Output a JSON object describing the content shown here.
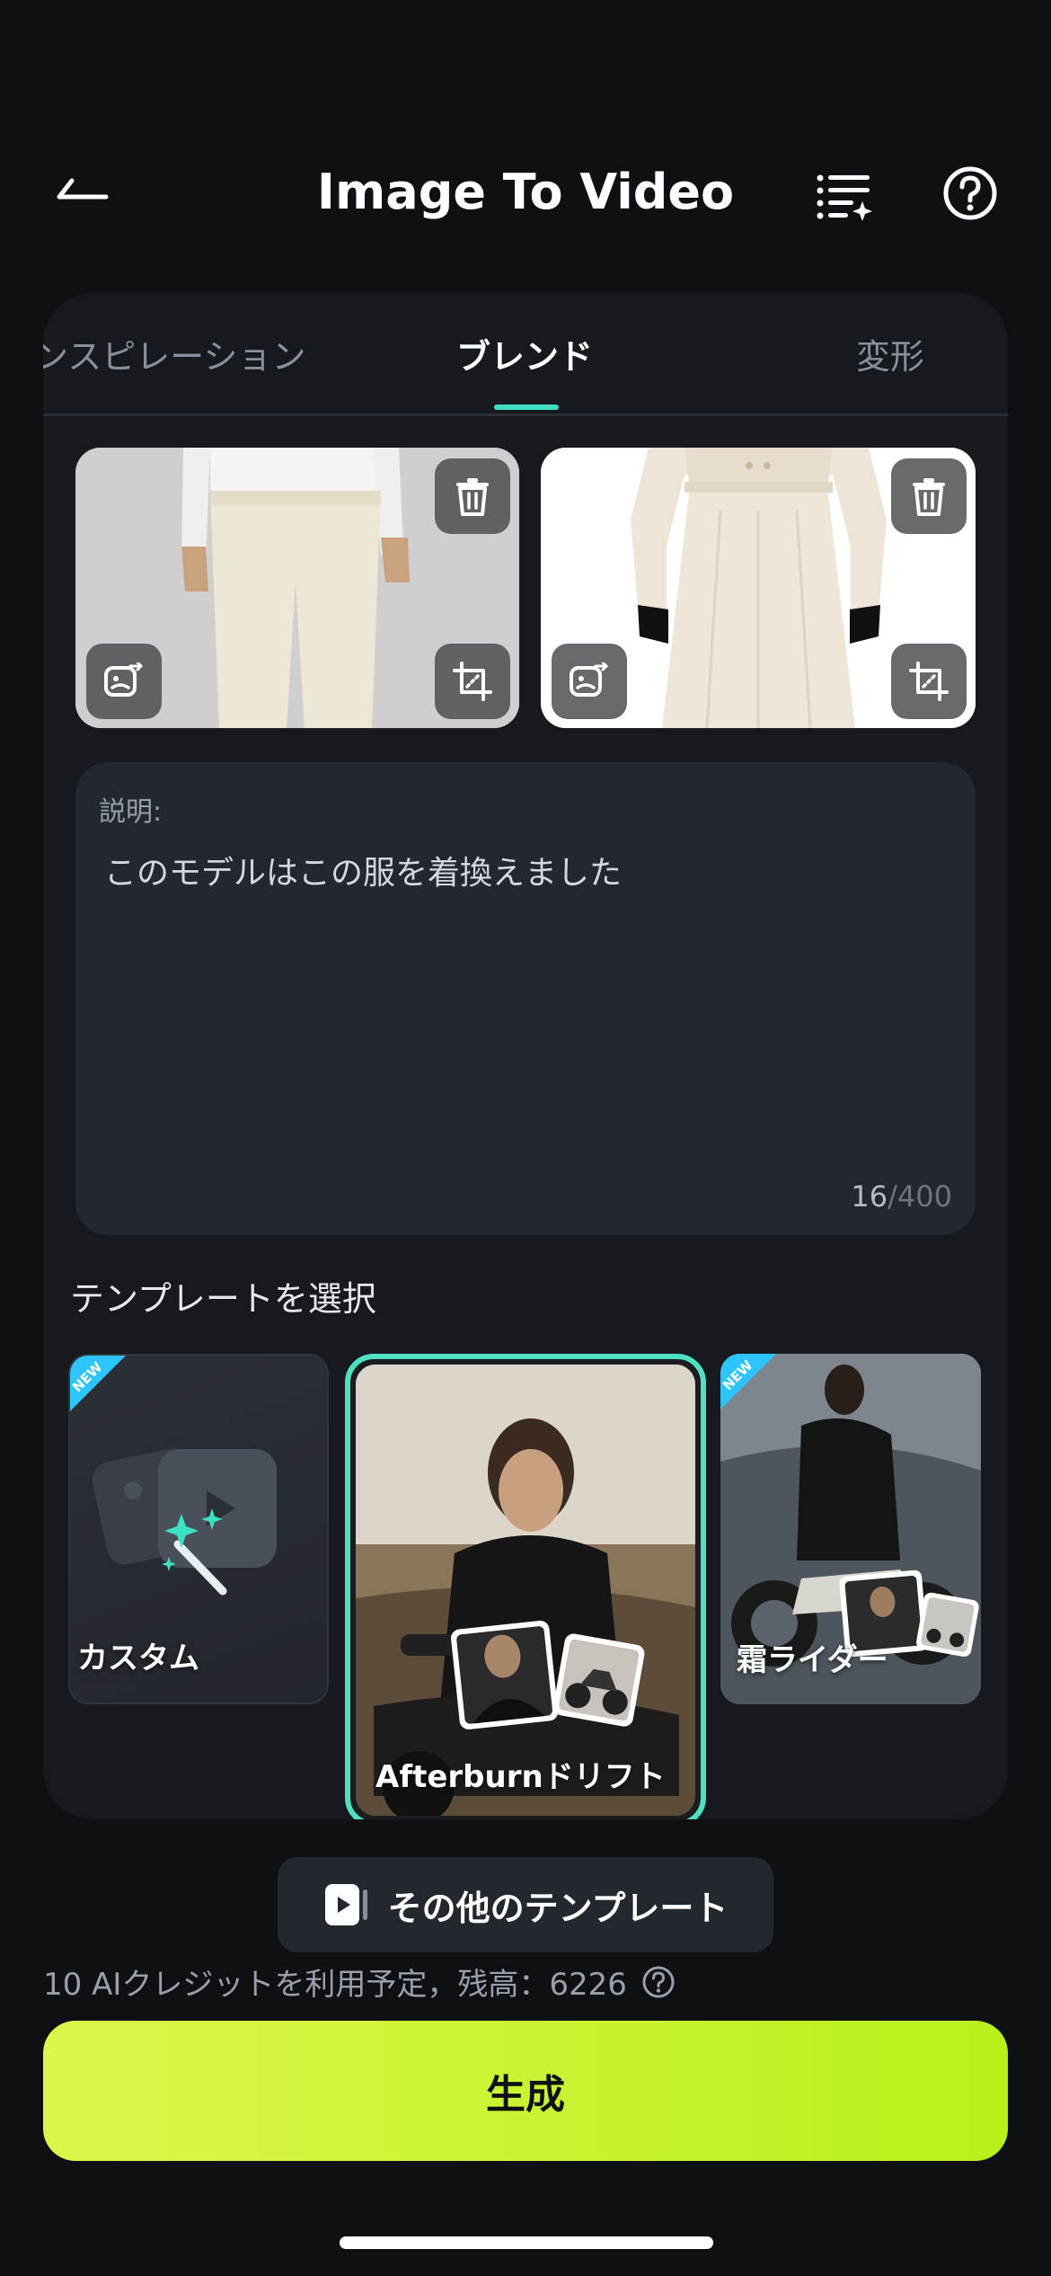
{
  "header": {
    "title": "Image To Video"
  },
  "tabs": [
    {
      "label": "ンスピレーション"
    },
    {
      "label": "ブレンド"
    },
    {
      "label": "変形"
    }
  ],
  "description": {
    "label": "説明:",
    "text": "このモデルはこの服を着換えました",
    "count_current": "16",
    "count_max": "/400"
  },
  "templates": {
    "heading": "テンプレートを選択",
    "items": [
      {
        "label": "カスタム",
        "badge": "NEW"
      },
      {
        "label": "Afterburnドリフト",
        "selected": true
      },
      {
        "label": "霜ライダー",
        "badge": "NEW"
      }
    ],
    "more_label": "その他のテンプレート"
  },
  "credit_text": "10 AIクレジットを利用予定，残高：6226",
  "generate_label": "生成",
  "colors": {
    "accent": "#4ee0c0",
    "generate": "#c8f52c",
    "background": "#0e1014"
  }
}
